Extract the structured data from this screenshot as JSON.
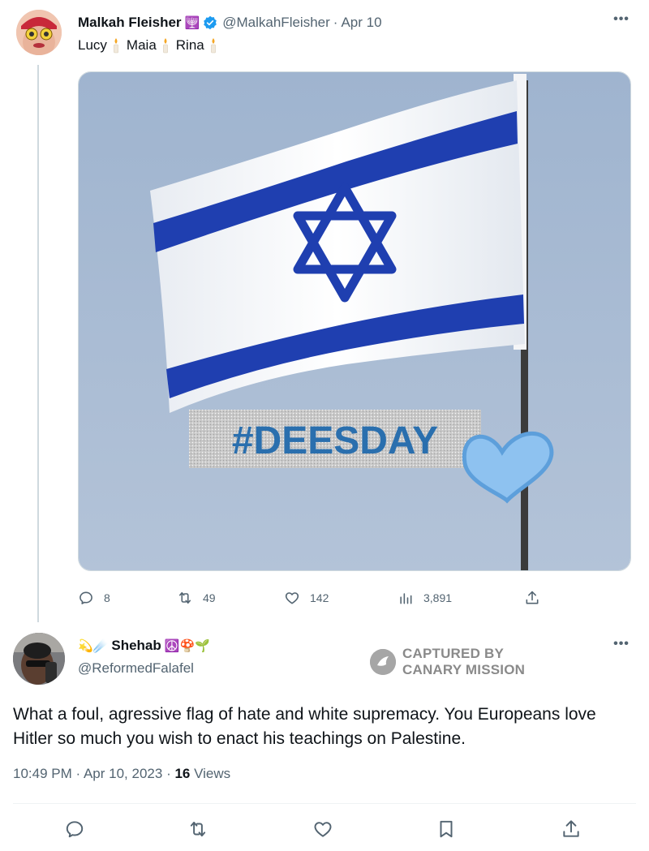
{
  "tweet": {
    "author_name": "Malkah Fleisher",
    "name_emoji": "🕎",
    "handle": "@MalkahFleisher",
    "separator": "·",
    "date": "Apr 10",
    "text_names": [
      "Lucy",
      "Maia",
      "Rina"
    ],
    "media_overlay_text": "#DEESDAY",
    "stats": {
      "replies": "8",
      "retweets": "49",
      "likes": "142",
      "views": "3,891"
    }
  },
  "reply": {
    "name_prefix_emoji": "💫☄️",
    "author_name": "Shehab",
    "name_suffix_emoji": "☮️🍄🌱",
    "handle": "@ReformedFalafel",
    "body": "What a foul, agressive flag of hate and white supremacy. You Europeans love Hitler so much you wish to enact his teachings on Palestine.",
    "time": "10:49 PM",
    "separator1": "·",
    "date": "Apr 10, 2023",
    "separator2": "·",
    "views_count": "16",
    "views_label": "Views"
  },
  "watermark": {
    "line1": "CAPTURED BY",
    "line2": "CANARY MISSION"
  },
  "icons": {
    "more": "more-dots-icon",
    "reply": "reply-icon",
    "retweet": "retweet-icon",
    "like": "heart-icon",
    "views": "analytics-icon",
    "share": "share-icon",
    "bookmark": "bookmark-icon",
    "verified": "verified-badge-icon"
  },
  "colors": {
    "flag_blue": "#1f3fb0",
    "verified_blue": "#1d9bf0",
    "muted_text": "#536471",
    "sky": "#a9bcd4"
  }
}
